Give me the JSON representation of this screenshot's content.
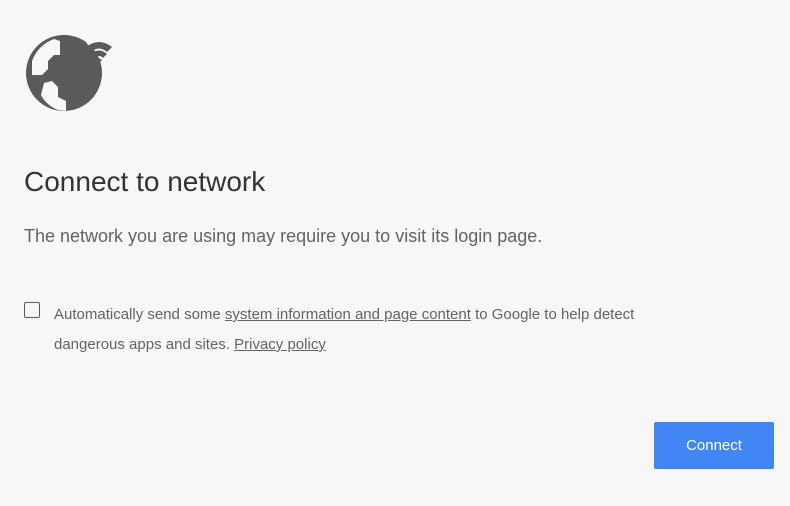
{
  "interstitial": {
    "icon": "globe-wifi-icon",
    "title": "Connect to network",
    "subtitle": "The network you are using may require you to visit its login page.",
    "optin": {
      "checked": false,
      "text_before": "Automatically send some ",
      "link_system_info": "system information and page content",
      "text_after": " to Google to help detect",
      "line2_text": "dangerous apps and sites. ",
      "link_privacy": "Privacy policy"
    },
    "connect_button": "Connect",
    "colors": {
      "background": "#f7f7f7",
      "title": "#333333",
      "body_text": "#646464",
      "icon": "#5a5a5a",
      "button": "#4285f4",
      "button_text": "#ffffff"
    }
  }
}
